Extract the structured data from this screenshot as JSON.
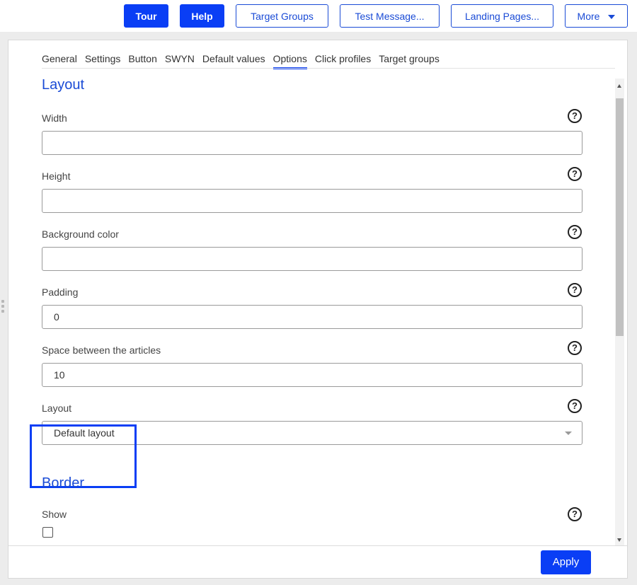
{
  "topbar": {
    "tour_label": "Tour",
    "help_label": "Help",
    "target_groups_label": "Target Groups",
    "test_message_label": "Test Message...",
    "landing_pages_label": "Landing Pages...",
    "more_label": "More"
  },
  "tabs": [
    "General",
    "Settings",
    "Button",
    "SWYN",
    "Default values",
    "Options",
    "Click profiles",
    "Target groups"
  ],
  "active_tab": "Options",
  "layout_section": {
    "title": "Layout",
    "fields": {
      "width": {
        "label": "Width",
        "value": ""
      },
      "height": {
        "label": "Height",
        "value": ""
      },
      "background_color": {
        "label": "Background color",
        "value": ""
      },
      "padding": {
        "label": "Padding",
        "value": "0"
      },
      "space_between": {
        "label": "Space between the articles",
        "value": "10"
      },
      "layout": {
        "label": "Layout",
        "value": "Default layout"
      }
    }
  },
  "border_section": {
    "title": "Border",
    "show_label": "Show",
    "show_checked": false
  },
  "footer": {
    "apply_label": "Apply"
  },
  "colors": {
    "primary": "#0a3ef5",
    "link": "#1a4bd6",
    "highlight": "#0a3ef5"
  }
}
